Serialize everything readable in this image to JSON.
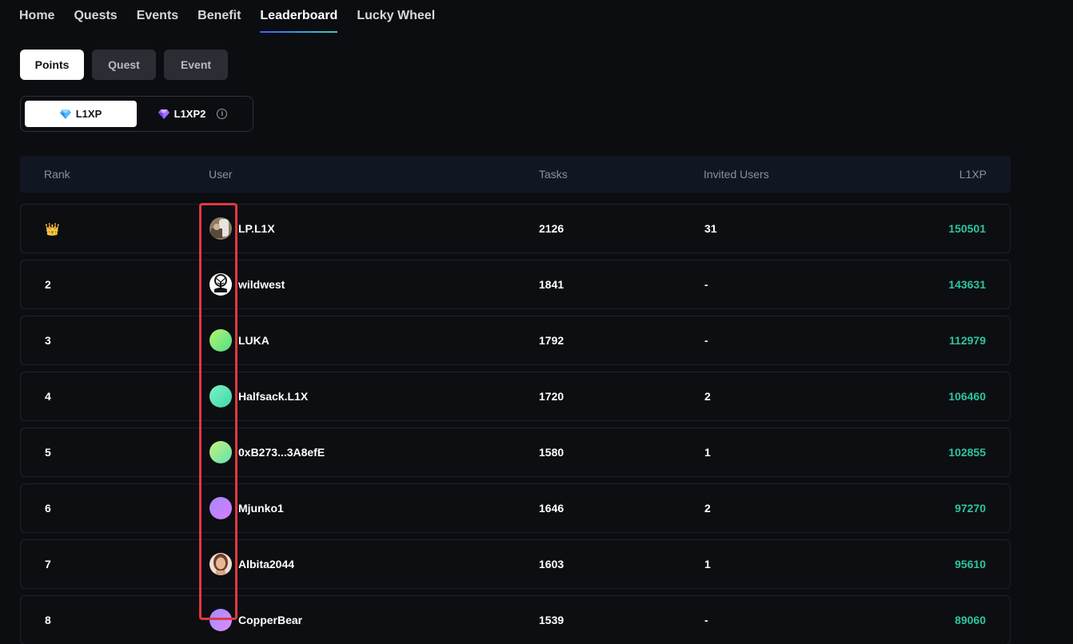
{
  "nav": {
    "items": [
      {
        "label": "Home",
        "active": false
      },
      {
        "label": "Quests",
        "active": false
      },
      {
        "label": "Events",
        "active": false
      },
      {
        "label": "Benefit",
        "active": false
      },
      {
        "label": "Leaderboard",
        "active": true
      },
      {
        "label": "Lucky Wheel",
        "active": false
      }
    ]
  },
  "tabs": {
    "points": "Points",
    "quest": "Quest",
    "event": "Event",
    "active": "Points"
  },
  "currency": {
    "l1xp": "L1XP",
    "l1xp2": "L1XP2",
    "l1xp_icon": "blue-diamond-icon",
    "l1xp2_icon": "purple-gem-icon",
    "active": "L1XP"
  },
  "table": {
    "headers": {
      "rank": "Rank",
      "user": "User",
      "tasks": "Tasks",
      "invited": "Invited Users",
      "xp": "L1XP"
    },
    "rows": [
      {
        "rank": "",
        "rank_icon": "crown-icon",
        "name": "LP.L1X",
        "tasks": "2126",
        "invited": "31",
        "xp": "150501",
        "avatar": "photo",
        "avatar_colors": [
          "#c9c3b8",
          "#6b5a48"
        ]
      },
      {
        "rank": "2",
        "name": "wildwest",
        "tasks": "1841",
        "invited": "-",
        "xp": "143631",
        "avatar": "tree",
        "avatar_colors": [
          "#ffffff",
          "#111111"
        ]
      },
      {
        "rank": "3",
        "name": "LUKA",
        "tasks": "1792",
        "invited": "-",
        "xp": "112979",
        "avatar": "gradient",
        "avatar_colors": [
          "#b6f36c",
          "#4fe08d"
        ]
      },
      {
        "rank": "4",
        "name": "Halfsack.L1X",
        "tasks": "1720",
        "invited": "2",
        "xp": "106460",
        "avatar": "gradient",
        "avatar_colors": [
          "#7df2c4",
          "#3fd8a8"
        ]
      },
      {
        "rank": "5",
        "name": "0xB273...3A8efE",
        "tasks": "1580",
        "invited": "1",
        "xp": "102855",
        "avatar": "gradient",
        "avatar_colors": [
          "#c8f27a",
          "#5fe3b0"
        ]
      },
      {
        "rank": "6",
        "name": "Mjunko1",
        "tasks": "1646",
        "invited": "2",
        "xp": "97270",
        "avatar": "gradient",
        "avatar_colors": [
          "#a58bff",
          "#d77cff"
        ]
      },
      {
        "rank": "7",
        "name": "Albita2044",
        "tasks": "1603",
        "invited": "1",
        "xp": "95610",
        "avatar": "photo",
        "avatar_colors": [
          "#e9c6a8",
          "#7a4a32"
        ]
      },
      {
        "rank": "8",
        "name": "CopperBear",
        "tasks": "1539",
        "invited": "-",
        "xp": "89060",
        "avatar": "gradient",
        "avatar_colors": [
          "#9b8cff",
          "#e08bff"
        ]
      }
    ]
  },
  "colors": {
    "accent_green": "#2ec4a0",
    "highlight_red": "#e0393e",
    "nav_underline": "#35d0c0"
  }
}
